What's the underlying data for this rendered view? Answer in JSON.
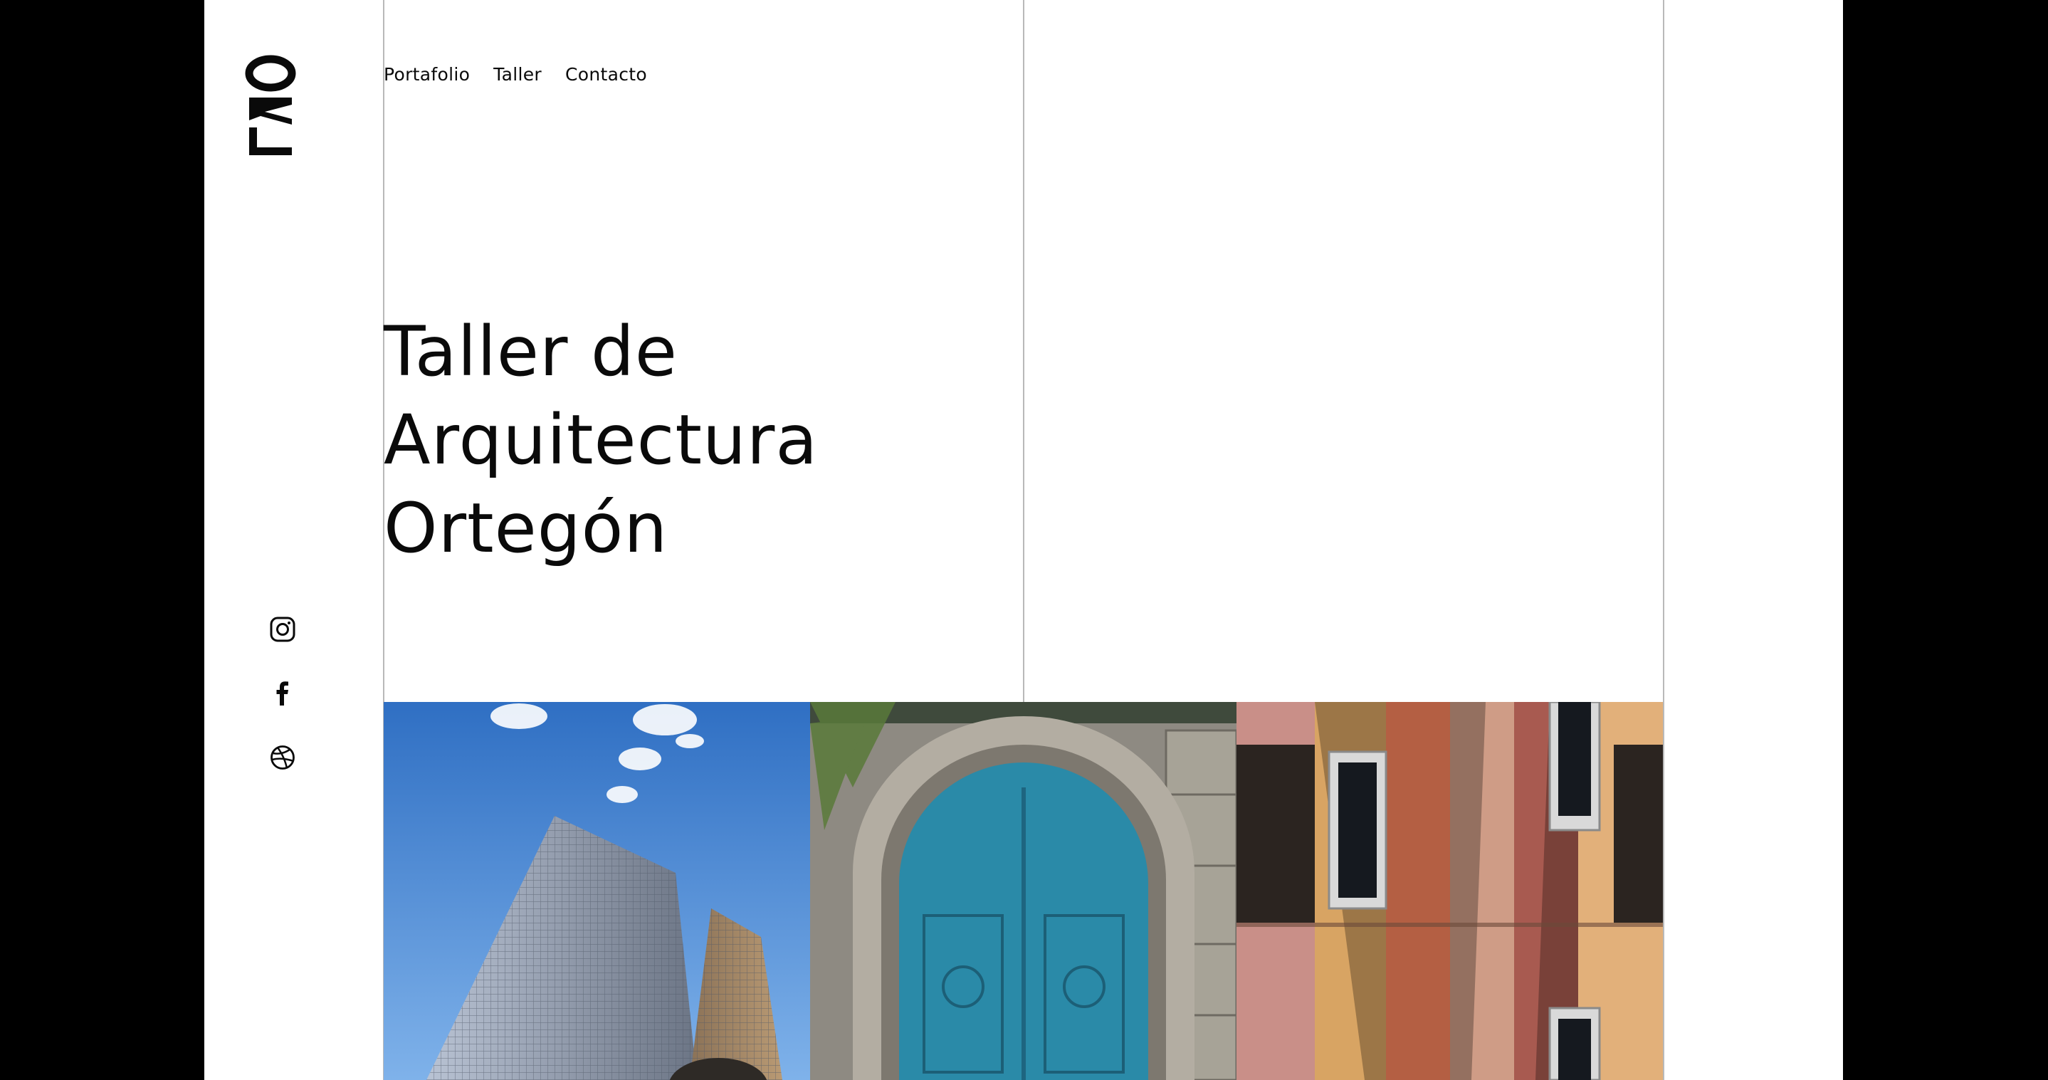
{
  "brand": {
    "logo_text": "TAO"
  },
  "nav": {
    "items": [
      {
        "label": "Portafolio"
      },
      {
        "label": "Taller"
      },
      {
        "label": "Contacto"
      }
    ]
  },
  "hero": {
    "title_lines": [
      "Taller de",
      "Arquitectura",
      "Ortegón"
    ]
  },
  "social": [
    {
      "icon": "instagram-icon"
    },
    {
      "icon": "facebook-icon"
    },
    {
      "icon": "dribbble-icon"
    }
  ],
  "gallery": [
    {
      "subject": "skyscraper"
    },
    {
      "subject": "blue-arched-door"
    },
    {
      "subject": "colored-facade"
    }
  ],
  "colors": {
    "background": "#ffffff",
    "outer_band": "#000000",
    "text": "#0a0a0a",
    "divider": "#b9b9b9",
    "sky_blue": "#4a86d0",
    "door_teal": "#2a8aa8"
  }
}
